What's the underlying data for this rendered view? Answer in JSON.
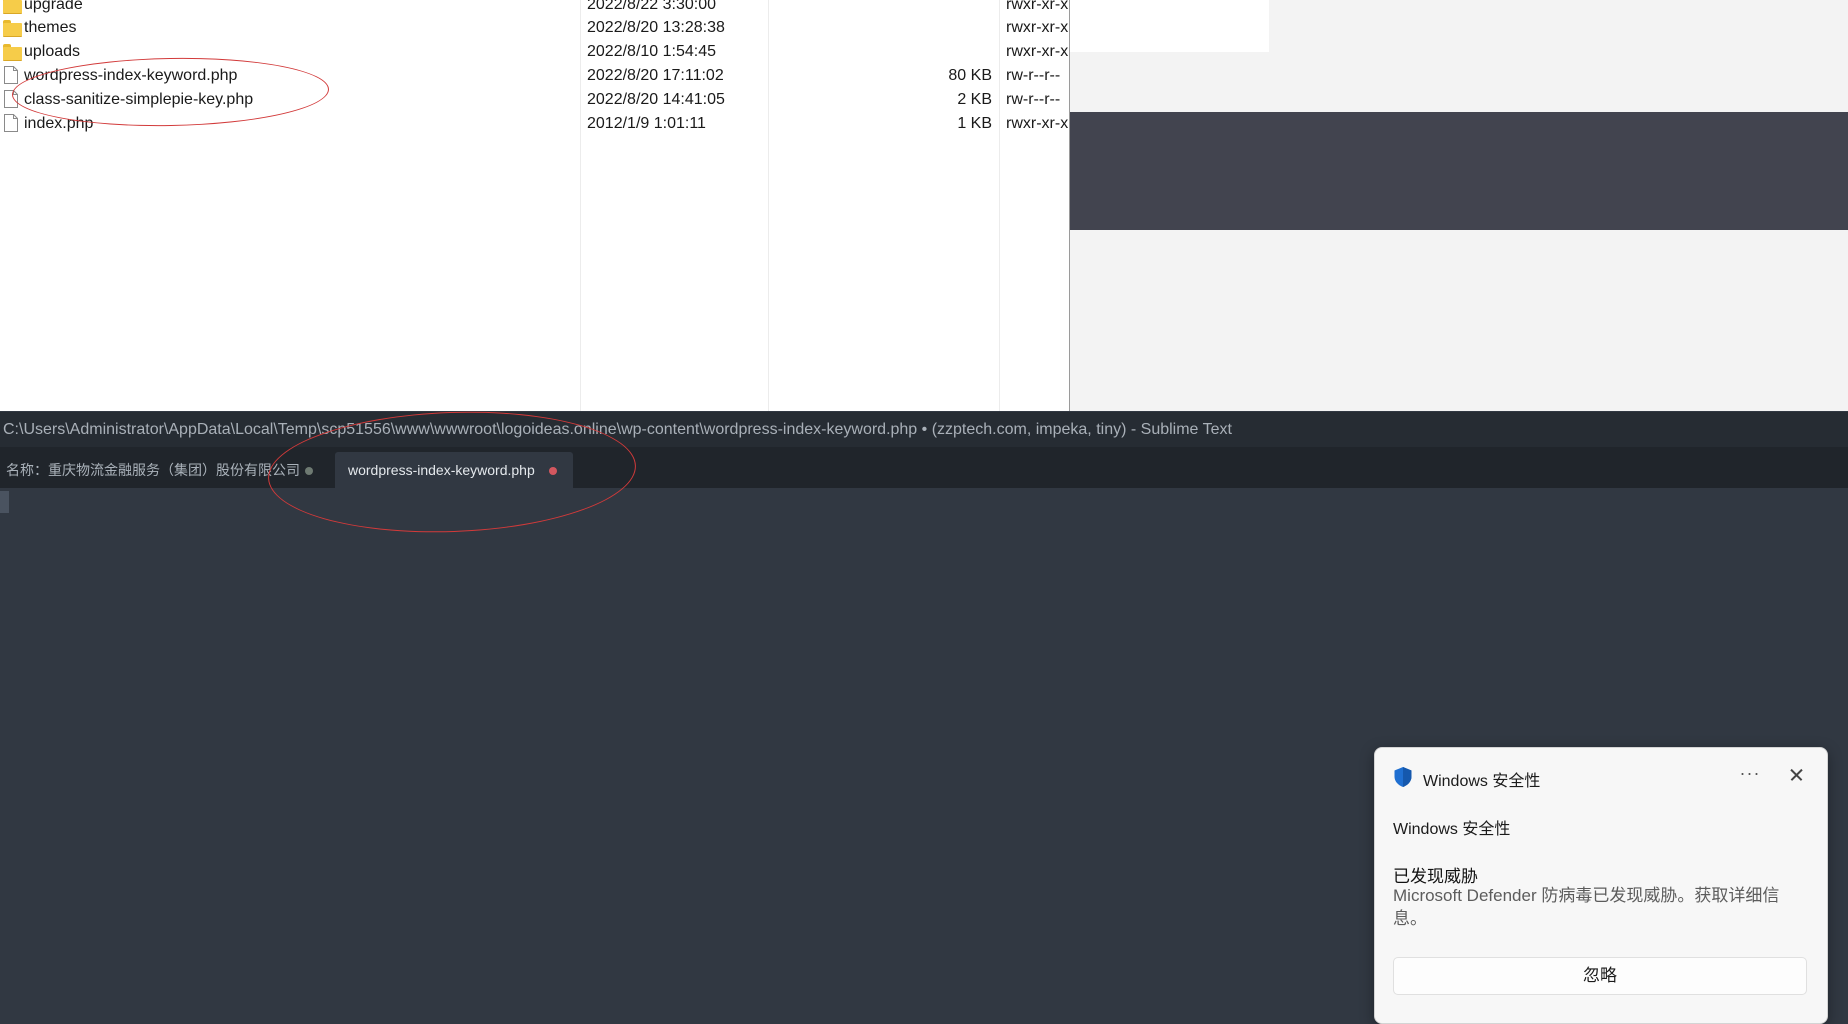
{
  "files": [
    {
      "name": "upgrade",
      "date": "2022/8/22 3:30:00",
      "size": "",
      "perm": "rwxr-xr-x",
      "type": "folder"
    },
    {
      "name": "themes",
      "date": "2022/8/20 13:28:38",
      "size": "",
      "perm": "rwxr-xr-x",
      "type": "folder"
    },
    {
      "name": "uploads",
      "date": "2022/8/10 1:54:45",
      "size": "",
      "perm": "rwxr-xr-x",
      "type": "folder"
    },
    {
      "name": "wordpress-index-keyword.php",
      "date": "2022/8/20 17:11:02",
      "size": "80 KB",
      "perm": "rw-r--r--",
      "type": "file"
    },
    {
      "name": "class-sanitize-simplepie-key.php",
      "date": "2022/8/20 14:41:05",
      "size": "2 KB",
      "perm": "rw-r--r--",
      "type": "file"
    },
    {
      "name": "index.php",
      "date": "2012/1/9 1:01:11",
      "size": "1 KB",
      "perm": "rwxr-xr-x",
      "type": "file"
    }
  ],
  "editor": {
    "title": "C:\\Users\\Administrator\\AppData\\Local\\Temp\\scp51556\\www\\wwwroot\\logoideas.online\\wp-content\\wordpress-index-keyword.php • (zzptech.com, impeka, tiny) - Sublime Text",
    "tabs": [
      {
        "label": "名称：重庆物流金融服务（集团）股份有限公司"
      },
      {
        "label": "wordpress-index-keyword.php"
      }
    ]
  },
  "toast": {
    "app_name": "Windows 安全性",
    "more": "···",
    "header": "Windows 安全性",
    "title": "已发现威胁",
    "body": "Microsoft Defender 防病毒已发现威胁。获取详细信息。",
    "button": "忽略"
  },
  "colors": {
    "annotation": "#d23a3a",
    "modified_dot": "#d3575f",
    "saved_dot": "#6e7a72",
    "editor_bg": "#313842",
    "shield": "#1f6fd1"
  }
}
